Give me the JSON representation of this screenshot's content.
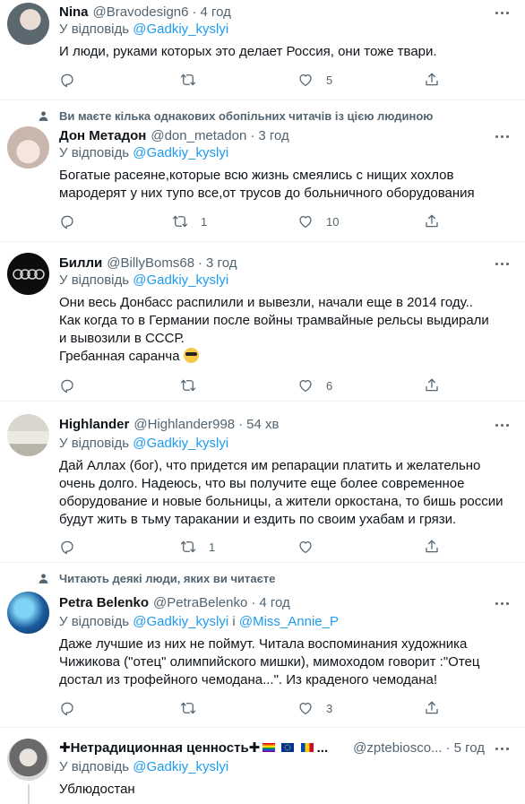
{
  "reply_prefix": "У відповідь",
  "tweets": [
    {
      "name": "Nina",
      "handle": "@Bravodesign6",
      "dot": "·",
      "time": "4 год",
      "mention": "@Gadkiy_kyslyi",
      "lines": [
        "И люди, руками которых это делает Россия, они тоже твари."
      ],
      "reply_count": "",
      "retweet_count": "",
      "like_count": "5"
    },
    {
      "social_context": "Ви маєте кілька однакових обопільних читачів із цією людиною",
      "name": "Дон Метадон",
      "handle": "@don_metadon",
      "dot": "·",
      "time": "3 год",
      "mention": "@Gadkiy_kyslyi",
      "lines": [
        "Богатые расеяне,которые всю жизнь смеялись с нищих хохлов",
        "мародерят у них тупо все,от трусов до больничного оборудования"
      ],
      "reply_count": "",
      "retweet_count": "1",
      "like_count": "10"
    },
    {
      "name": "Билли",
      "handle": "@BillyBoms68",
      "dot": "·",
      "time": "3 год",
      "mention": "@Gadkiy_kyslyi",
      "lines": [
        "Они весь Донбасс распилили и вывезли, начали еще в 2014 году..",
        "Как когда то в Германии после  войны  трамвайные рельсы выдирали",
        "и вывозили в СССР.",
        "Гребанная саранча"
      ],
      "reply_count": "",
      "retweet_count": "",
      "like_count": "6"
    },
    {
      "name": "Highlander",
      "handle": "@Highlander998",
      "dot": "·",
      "time": "54 хв",
      "mention": "@Gadkiy_kyslyi",
      "lines": [
        "Дай Аллах (бог), что придется им репарации платить и желательно",
        "очень долго. Надеюсь, что вы получите еще более современное",
        "оборудование и новые больницы, а жители оркостана, то бишь россии",
        "будут жить в тьму таракании и ездить по своим ухабам и грязи."
      ],
      "reply_count": "",
      "retweet_count": "1",
      "like_count": ""
    },
    {
      "social_context": "Читають деякі люди, яких ви читаєте",
      "name": "Petra Belenko",
      "handle": "@PetraBelenko",
      "dot": "·",
      "time": "4 год",
      "mention": "@Gadkiy_kyslyi",
      "mention_joiner": " і ",
      "mention2": "@Miss_Annie_P",
      "lines": [
        "Даже лучшие из них не поймут. Читала воспоминания художника",
        "Чижикова (\"отец\" олимпийского мишки), мимоходом говорит :\"Отец",
        "достал из трофейного чемодана...\". Из краденого чемодана!"
      ],
      "reply_count": "",
      "retweet_count": "",
      "like_count": "3"
    },
    {
      "name": "✚Нетрадиционная ценность✚",
      "name_suffix": "...",
      "handle": "@zptebiosco...",
      "dot": "·",
      "time": "5 год",
      "mention": "@Gadkiy_kyslyi",
      "lines": [
        "Ублюдостан"
      ]
    }
  ],
  "colors": {
    "accent": "#1d9bf0",
    "muted": "#536471",
    "text": "#0f1419",
    "divider": "#eff3f4"
  },
  "icons": {
    "reply": "reply-icon",
    "retweet": "retweet-icon",
    "like": "heart-icon",
    "share": "share-icon",
    "more": "more-icon",
    "social_person": "person-icon",
    "emoji": "sunglasses-emoji-icon"
  }
}
